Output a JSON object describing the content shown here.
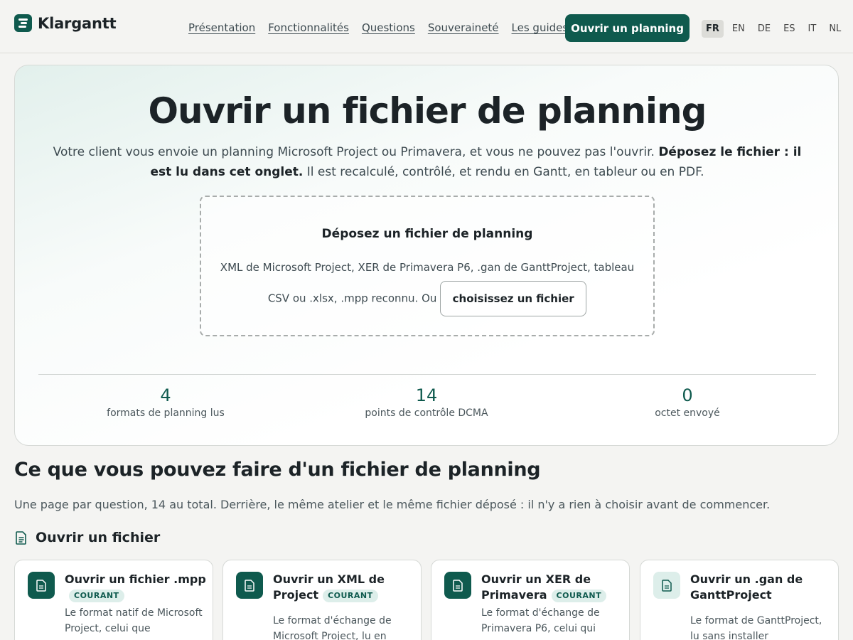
{
  "header": {
    "brand": "Klargantt",
    "nav": [
      "Présentation",
      "Fonctionnalités",
      "Questions",
      "Souveraineté",
      "Les guides"
    ],
    "cta": "Ouvrir un planning",
    "languages": [
      "FR",
      "EN",
      "DE",
      "ES",
      "IT",
      "NL"
    ],
    "active_language": "FR"
  },
  "hero": {
    "title": "Ouvrir un fichier de planning",
    "lead_part1": "Votre client vous envoie un planning Microsoft Project ou Primavera, et vous ne pouvez pas l'ouvrir. ",
    "lead_bold": "Déposez le fichier : il est lu dans cet onglet.",
    "lead_part2": " Il est recalculé, contrôlé, et rendu en Gantt, en tableur ou en PDF.",
    "dropzone": {
      "title": "Déposez un fichier de planning",
      "text": "XML de Microsoft Project, XER de Primavera P6, .gan de GanttProject, tableau CSV ou .xlsx, .mpp reconnu. Ou",
      "button": "choisissez un fichier"
    },
    "stats": [
      {
        "value": "4",
        "label": "formats de planning lus"
      },
      {
        "value": "14",
        "label": "points de contrôle DCMA"
      },
      {
        "value": "0",
        "label": "octet envoyé"
      }
    ]
  },
  "section": {
    "title": "Ce que vous pouvez faire d'un fichier de planning",
    "subtitle": "Une page par question, 14 au total. Derrière, le même atelier et le même fichier déposé : il n'y a rien à choisir avant de commencer.",
    "subheading": "Ouvrir un fichier",
    "icon": "document-icon",
    "cards": [
      {
        "title": "Ouvrir un fichier .mpp",
        "badge": "COURANT",
        "desc": "Le format natif de Microsoft Project, celui que"
      },
      {
        "title": "Ouvrir un XML de Project",
        "badge": "COURANT",
        "desc": "Le format d'échange de Microsoft Project, lu en"
      },
      {
        "title": "Ouvrir un XER de Primavera",
        "badge": "COURANT",
        "desc": "Le format d'échange de Primavera P6, celui qui"
      },
      {
        "title": "Ouvrir un .gan de GanttProject",
        "badge": "",
        "desc": "Le format de GanttProject, lu sans installer"
      }
    ]
  },
  "colors": {
    "accent": "#0f5a4e",
    "accent_light": "#ddeeea",
    "background": "#f4f4f2"
  }
}
